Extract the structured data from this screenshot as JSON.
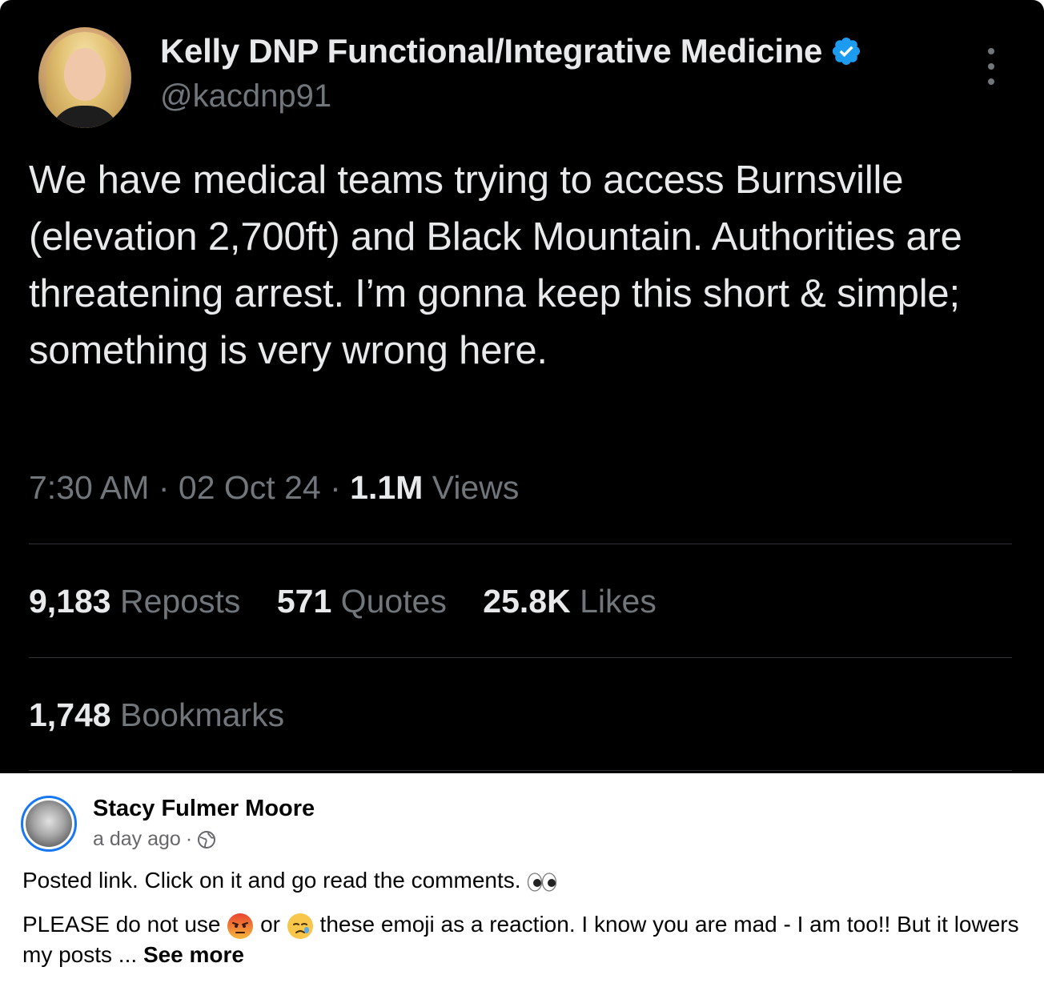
{
  "tweet": {
    "display_name": "Kelly DNP Functional/Integrative Medicine",
    "handle": "@kacdnp91",
    "text": "We have medical teams trying to access Burnsville (elevation 2,700ft) and Black Mountain. Authorities are threatening arrest. I’m gonna keep this short & simple; something is very wrong here.",
    "time": "7:30 AM",
    "date": "02 Oct 24",
    "views_count": "1.1M",
    "views_label": "Views",
    "separator": "·",
    "stats": [
      {
        "count": "9,183",
        "label": "Reposts"
      },
      {
        "count": "571",
        "label": "Quotes"
      },
      {
        "count": "25.8K",
        "label": "Likes"
      }
    ],
    "bookmarks_count": "1,748",
    "bookmarks_label": "Bookmarks",
    "verified_color": "#1d9bf0"
  },
  "fb_post": {
    "author": "Stacy Fulmer Moore",
    "time": "a day ago",
    "time_sep": "·",
    "privacy_icon": "globe-icon",
    "line1": "Posted link. Click on it and go read the comments.",
    "line1_emoji": "eyes-emoji",
    "line2_part1": "PLEASE do not use",
    "emoji1": "angry-emoji",
    "line2_or": "or",
    "emoji2": "sad-emoji",
    "line2_part2": "these emoji as a reaction. I know you are mad - I am too!! But it lowers my posts ...",
    "see_more": "See more",
    "accent_color": "#1877f2"
  }
}
